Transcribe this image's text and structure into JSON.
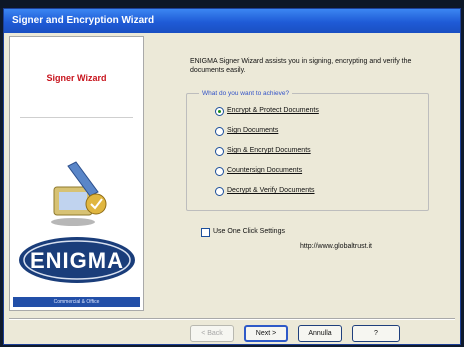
{
  "window": {
    "title": "Signer and Encryption Wizard"
  },
  "sidebar": {
    "title": "Signer Wizard",
    "logo_text": "ENIGMA",
    "footer": "Commercial & Office"
  },
  "main": {
    "intro": "ENIGMA Signer Wizard assists you in signing, encrypting and verify the documents easily.",
    "group_legend": "What do you want to achieve?",
    "options": [
      {
        "label": "Encrypt & Protect Documents",
        "checked": true
      },
      {
        "label": "Sign Documents",
        "checked": false
      },
      {
        "label": "Sign & Encrypt Documents",
        "checked": false
      },
      {
        "label": "Countersign Documents",
        "checked": false
      },
      {
        "label": "Decrypt & Verify Documents",
        "checked": false
      }
    ],
    "one_click_label": "Use One Click Settings",
    "one_click_checked": false,
    "url": "http://www.globaltrust.it"
  },
  "buttons": {
    "back": "< Back",
    "next": "Next >",
    "cancel": "Annulla",
    "help": "?"
  },
  "colors": {
    "title_bar": "#1f5bd6",
    "accent_red": "#c8141d",
    "legend_blue": "#3353c7"
  }
}
